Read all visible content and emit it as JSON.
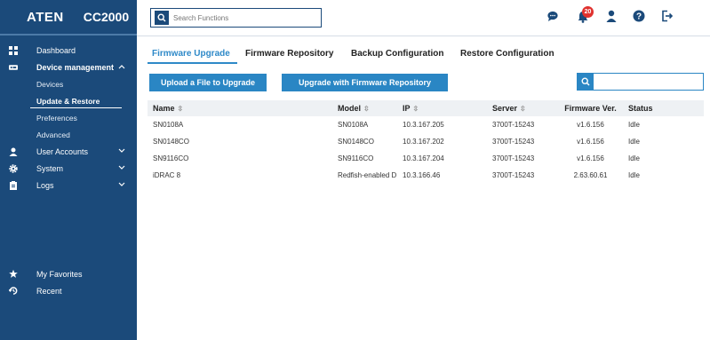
{
  "brand": {
    "logo": "ATEN",
    "model": "CC2000"
  },
  "sidebar": {
    "items": [
      {
        "label": "Dashboard",
        "icon": "dashboard-icon"
      },
      {
        "label": "Device management",
        "icon": "device-management-icon",
        "expanded": true,
        "children": [
          {
            "label": "Devices"
          },
          {
            "label": "Update & Restore",
            "active": true
          },
          {
            "label": "Preferences"
          },
          {
            "label": "Advanced"
          }
        ]
      },
      {
        "label": "User Accounts",
        "icon": "user-icon"
      },
      {
        "label": "System",
        "icon": "gear-icon"
      },
      {
        "label": "Logs",
        "icon": "clipboard-icon"
      }
    ],
    "bottom": [
      {
        "label": "My Favorites",
        "icon": "star-icon"
      },
      {
        "label": "Recent",
        "icon": "history-icon"
      }
    ]
  },
  "topbar": {
    "search_placeholder": "Search Functions",
    "notification_count": "20",
    "icons": [
      "chat-icon",
      "bell-icon",
      "user-icon",
      "help-icon",
      "logout-icon"
    ]
  },
  "tabs": [
    {
      "label": "Firmware Upgrade",
      "active": true
    },
    {
      "label": "Firmware Repository"
    },
    {
      "label": "Backup Configuration"
    },
    {
      "label": "Restore Configuration"
    }
  ],
  "buttons": {
    "upload": "Upload a File to Upgrade",
    "upgrade_repo": "Upgrade with Firmware Repository"
  },
  "table": {
    "columns": [
      "Name",
      "Model",
      "IP",
      "Server",
      "Firmware Ver.",
      "Status"
    ],
    "rows": [
      [
        "SN0108A",
        "SN0108A",
        "10.3.167.205",
        "3700T-15243",
        "v1.6.156",
        "Idle"
      ],
      [
        "SN0148CO",
        "SN0148CO",
        "10.3.167.202",
        "3700T-15243",
        "v1.6.156",
        "Idle"
      ],
      [
        "SN9116CO",
        "SN9116CO",
        "10.3.167.204",
        "3700T-15243",
        "v1.6.156",
        "Idle"
      ],
      [
        "iDRAC 8",
        "Redfish-enabled D",
        "10.3.166.46",
        "3700T-15243",
        "2.63.60.61",
        "Idle"
      ]
    ]
  },
  "colors": {
    "sidebar_bg": "#1b4a7a",
    "accent": "#2a86c4",
    "notification": "#e0322f"
  }
}
